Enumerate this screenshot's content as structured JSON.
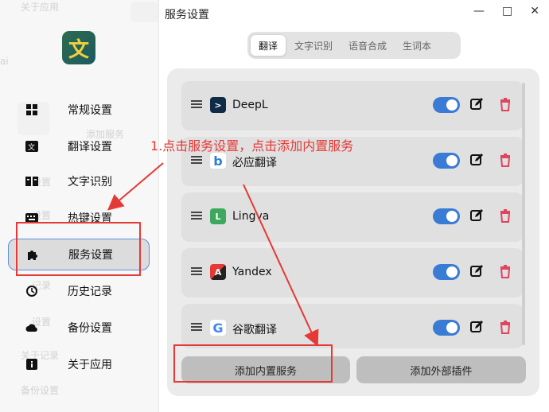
{
  "window": {
    "title": "服务设置",
    "controls": [
      "—",
      "□",
      "✕"
    ]
  },
  "sidebar": {
    "background_ghosts": [
      "关于应用",
      "ai",
      "添加服务",
      "设置",
      "设置",
      "记录",
      "设置",
      "关于记录",
      "备份设置"
    ],
    "logo_text": "文",
    "items": [
      {
        "label": "常规设置",
        "icon": "grid-icon"
      },
      {
        "label": "翻译设置",
        "icon": "translate-icon"
      },
      {
        "label": "文字识别",
        "icon": "book-icon"
      },
      {
        "label": "热键设置",
        "icon": "keyboard-icon"
      },
      {
        "label": "服务设置",
        "icon": "puzzle-icon",
        "active": true
      },
      {
        "label": "历史记录",
        "icon": "history-icon"
      },
      {
        "label": "备份设置",
        "icon": "cloud-icon"
      },
      {
        "label": "关于应用",
        "icon": "info-icon"
      }
    ]
  },
  "tabs": [
    {
      "label": "翻译",
      "active": true
    },
    {
      "label": "文字识别"
    },
    {
      "label": "语音合成"
    },
    {
      "label": "生词本"
    }
  ],
  "services": [
    {
      "name": "DeepL",
      "icon": "deepl-icon",
      "enabled": true,
      "icon_color": "#0f2b46",
      "glyph": ">"
    },
    {
      "name": "必应翻译",
      "icon": "bing-icon",
      "enabled": true,
      "icon_color": "#ffffff",
      "glyph": "b"
    },
    {
      "name": "Lingva",
      "icon": "lingva-icon",
      "enabled": true,
      "icon_color": "#3ea85f",
      "glyph": "L"
    },
    {
      "name": "Yandex",
      "icon": "yandex-icon",
      "enabled": true,
      "icon_color": "#e53935",
      "glyph": "A"
    },
    {
      "name": "谷歌翻译",
      "icon": "google-icon",
      "enabled": true,
      "icon_color": "#ffffff",
      "glyph": "G"
    }
  ],
  "buttons": {
    "add_builtin": "添加内置服务",
    "add_external": "添加外部插件"
  },
  "annotation": {
    "text": "1.点击服务设置，点击添加内置服务",
    "color": "#e53935"
  },
  "colors": {
    "accent": "#3a7bd5",
    "delete": "#e0445e",
    "annotation": "#e53935"
  }
}
